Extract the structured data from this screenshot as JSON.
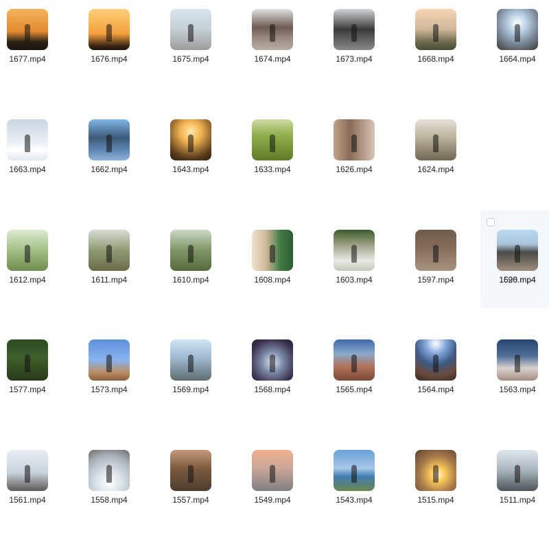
{
  "files": [
    {
      "name": "1677.mp4",
      "thumb": "sunset-icon"
    },
    {
      "name": "1676.mp4",
      "thumb": "sunset-icon"
    },
    {
      "name": "1675.mp4",
      "thumb": "road-icon"
    },
    {
      "name": "1674.mp4",
      "thumb": "crowd-icon"
    },
    {
      "name": "1673.mp4",
      "thumb": "runners-icon"
    },
    {
      "name": "1668.mp4",
      "thumb": "hill-icon"
    },
    {
      "name": "1664.mp4",
      "thumb": "beach-icon"
    },
    {
      "name": "1663.mp4",
      "thumb": "snow-icon"
    },
    {
      "name": "1662.mp4",
      "thumb": "ice-icon"
    },
    {
      "name": "1643.mp4",
      "thumb": "field-icon"
    },
    {
      "name": "1633.mp4",
      "thumb": "grass-icon"
    },
    {
      "name": "1626.mp4",
      "thumb": "girl-icon"
    },
    {
      "name": "1624.mp4",
      "thumb": "park-icon"
    },
    {
      "name": "1620.mp4",
      "thumb": "silhouette-icon"
    },
    {
      "name": "1612.mp4",
      "thumb": "tree-icon"
    },
    {
      "name": "1611.mp4",
      "thumb": "woods-icon"
    },
    {
      "name": "1610.mp4",
      "thumb": "swing-icon"
    },
    {
      "name": "1608.mp4",
      "thumb": "face-icon"
    },
    {
      "name": "1603.mp4",
      "thumb": "flowers-icon"
    },
    {
      "name": "1597.mp4",
      "thumb": "path-icon"
    },
    {
      "name": "1596.mp4",
      "thumb": "shore-icon"
    },
    {
      "name": "1577.mp4",
      "thumb": "forest-icon"
    },
    {
      "name": "1573.mp4",
      "thumb": "jump-icon"
    },
    {
      "name": "1569.mp4",
      "thumb": "selfie-icon"
    },
    {
      "name": "1568.mp4",
      "thumb": "water-icon"
    },
    {
      "name": "1565.mp4",
      "thumb": "rock-icon"
    },
    {
      "name": "1564.mp4",
      "thumb": "rock-icon"
    },
    {
      "name": "1563.mp4",
      "thumb": "rock-icon"
    },
    {
      "name": "1561.mp4",
      "thumb": "person-icon"
    },
    {
      "name": "1558.mp4",
      "thumb": "person-icon"
    },
    {
      "name": "1557.mp4",
      "thumb": "hands-icon"
    },
    {
      "name": "1549.mp4",
      "thumb": "feet-icon"
    },
    {
      "name": "1543.mp4",
      "thumb": "lake-icon"
    },
    {
      "name": "1515.mp4",
      "thumb": "glare-icon"
    },
    {
      "name": "1511.mp4",
      "thumb": "skate-icon"
    }
  ],
  "hovered_file": "1620.mp4",
  "hover_color": "#f3f6fa",
  "label_color": "#222222"
}
